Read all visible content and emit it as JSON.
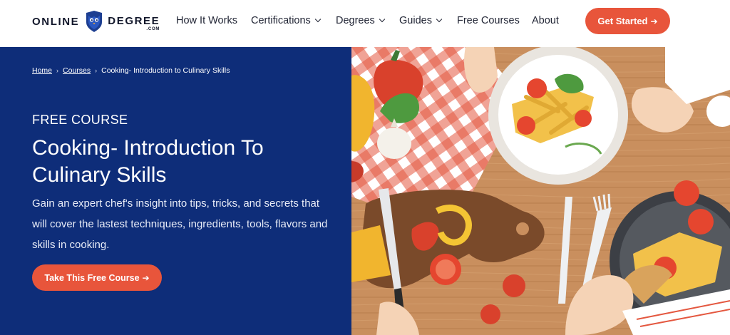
{
  "brand": {
    "left": "ONLINE",
    "right": "DEGREE",
    "suffix": ".COM",
    "accent": "#1d3e91"
  },
  "nav": {
    "items": [
      {
        "label": "How It Works",
        "dropdown": false
      },
      {
        "label": "Certifications",
        "dropdown": true
      },
      {
        "label": "Degrees",
        "dropdown": true
      },
      {
        "label": "Guides",
        "dropdown": true
      },
      {
        "label": "Free Courses",
        "dropdown": false
      },
      {
        "label": "About",
        "dropdown": false
      }
    ],
    "cta_label": "Get Started",
    "cta_arrow": "➔"
  },
  "breadcrumb": {
    "home": "Home",
    "courses": "Courses",
    "current": "Cooking- Introduction to Culinary Skills"
  },
  "hero": {
    "eyebrow": "FREE COURSE",
    "title": "Cooking- Introduction To Culinary Skills",
    "description": "Gain an expert chef's insight into tips, tricks, and secrets that will cover the lastest techniques, ingredients, tools, flavors and skills in cooking.",
    "button_label": "Take This Free Course",
    "button_arrow": "➔"
  },
  "colors": {
    "hero_bg": "#0e2d79",
    "cta": "#e8553b",
    "text_dark": "#1f2333"
  },
  "image": {
    "icon": "cooking-illustration"
  }
}
